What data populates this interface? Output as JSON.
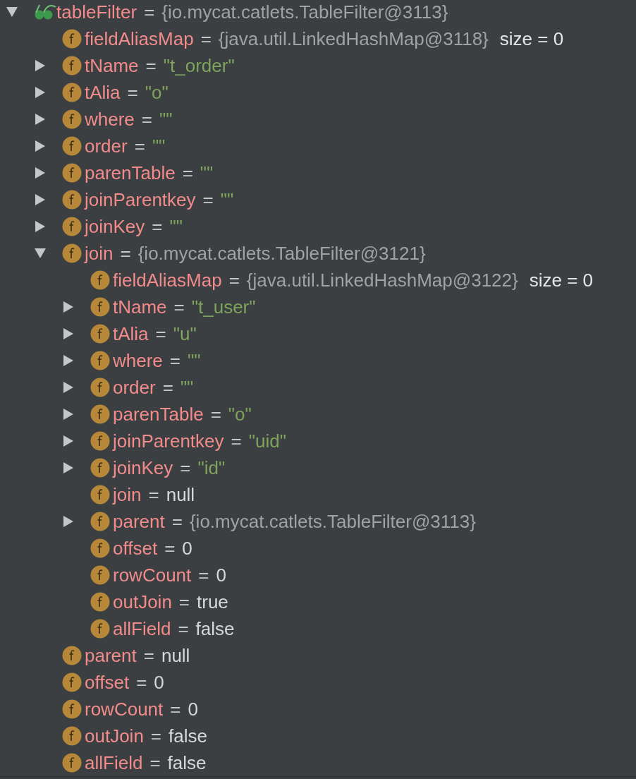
{
  "variables": [
    {
      "kind": "watch",
      "name": "tableFilter",
      "operator": "=",
      "value": {
        "kind": "object",
        "text": "{io.mycat.catlets.TableFilter@3113}"
      },
      "expanded": true,
      "children": [
        {
          "kind": "field",
          "name": "fieldAliasMap",
          "operator": "=",
          "value": {
            "kind": "object",
            "text": "{java.util.LinkedHashMap@3118}"
          },
          "size": "size = 0"
        },
        {
          "kind": "field",
          "name": "tName",
          "operator": "=",
          "value": {
            "kind": "string",
            "text": "\"t_order\""
          },
          "expanded": false
        },
        {
          "kind": "field",
          "name": "tAlia",
          "operator": "=",
          "value": {
            "kind": "string",
            "text": "\"o\""
          },
          "expanded": false
        },
        {
          "kind": "field",
          "name": "where",
          "operator": "=",
          "value": {
            "kind": "string",
            "text": "\"\""
          },
          "expanded": false
        },
        {
          "kind": "field",
          "name": "order",
          "operator": "=",
          "value": {
            "kind": "string",
            "text": "\"\""
          },
          "expanded": false
        },
        {
          "kind": "field",
          "name": "parenTable",
          "operator": "=",
          "value": {
            "kind": "string",
            "text": "\"\""
          },
          "expanded": false
        },
        {
          "kind": "field",
          "name": "joinParentkey",
          "operator": "=",
          "value": {
            "kind": "string",
            "text": "\"\""
          },
          "expanded": false
        },
        {
          "kind": "field",
          "name": "joinKey",
          "operator": "=",
          "value": {
            "kind": "string",
            "text": "\"\""
          },
          "expanded": false
        },
        {
          "kind": "field",
          "name": "join",
          "operator": "=",
          "value": {
            "kind": "object",
            "text": "{io.mycat.catlets.TableFilter@3121}"
          },
          "expanded": true,
          "children": [
            {
              "kind": "field",
              "name": "fieldAliasMap",
              "operator": "=",
              "value": {
                "kind": "object",
                "text": "{java.util.LinkedHashMap@3122}"
              },
              "size": "size = 0"
            },
            {
              "kind": "field",
              "name": "tName",
              "operator": "=",
              "value": {
                "kind": "string",
                "text": "\"t_user\""
              },
              "expanded": false
            },
            {
              "kind": "field",
              "name": "tAlia",
              "operator": "=",
              "value": {
                "kind": "string",
                "text": "\"u\""
              },
              "expanded": false
            },
            {
              "kind": "field",
              "name": "where",
              "operator": "=",
              "value": {
                "kind": "string",
                "text": "\"\""
              },
              "expanded": false
            },
            {
              "kind": "field",
              "name": "order",
              "operator": "=",
              "value": {
                "kind": "string",
                "text": "\"\""
              },
              "expanded": false
            },
            {
              "kind": "field",
              "name": "parenTable",
              "operator": "=",
              "value": {
                "kind": "string",
                "text": "\"o\""
              },
              "expanded": false
            },
            {
              "kind": "field",
              "name": "joinParentkey",
              "operator": "=",
              "value": {
                "kind": "string",
                "text": "\"uid\""
              },
              "expanded": false
            },
            {
              "kind": "field",
              "name": "joinKey",
              "operator": "=",
              "value": {
                "kind": "string",
                "text": "\"id\""
              },
              "expanded": false
            },
            {
              "kind": "field",
              "name": "join",
              "operator": "=",
              "value": {
                "kind": "literal",
                "text": "null"
              }
            },
            {
              "kind": "field",
              "name": "parent",
              "operator": "=",
              "value": {
                "kind": "object",
                "text": "{io.mycat.catlets.TableFilter@3113}"
              },
              "expanded": false
            },
            {
              "kind": "field",
              "name": "offset",
              "operator": "=",
              "value": {
                "kind": "literal",
                "text": "0"
              }
            },
            {
              "kind": "field",
              "name": "rowCount",
              "operator": "=",
              "value": {
                "kind": "literal",
                "text": "0"
              }
            },
            {
              "kind": "field",
              "name": "outJoin",
              "operator": "=",
              "value": {
                "kind": "literal",
                "text": "true"
              }
            },
            {
              "kind": "field",
              "name": "allField",
              "operator": "=",
              "value": {
                "kind": "literal",
                "text": "false"
              }
            }
          ]
        },
        {
          "kind": "field",
          "name": "parent",
          "operator": "=",
          "value": {
            "kind": "literal",
            "text": "null"
          }
        },
        {
          "kind": "field",
          "name": "offset",
          "operator": "=",
          "value": {
            "kind": "literal",
            "text": "0"
          }
        },
        {
          "kind": "field",
          "name": "rowCount",
          "operator": "=",
          "value": {
            "kind": "literal",
            "text": "0"
          }
        },
        {
          "kind": "field",
          "name": "outJoin",
          "operator": "=",
          "value": {
            "kind": "literal",
            "text": "false"
          }
        },
        {
          "kind": "field",
          "name": "allField",
          "operator": "=",
          "value": {
            "kind": "literal",
            "text": "false"
          }
        }
      ]
    }
  ]
}
